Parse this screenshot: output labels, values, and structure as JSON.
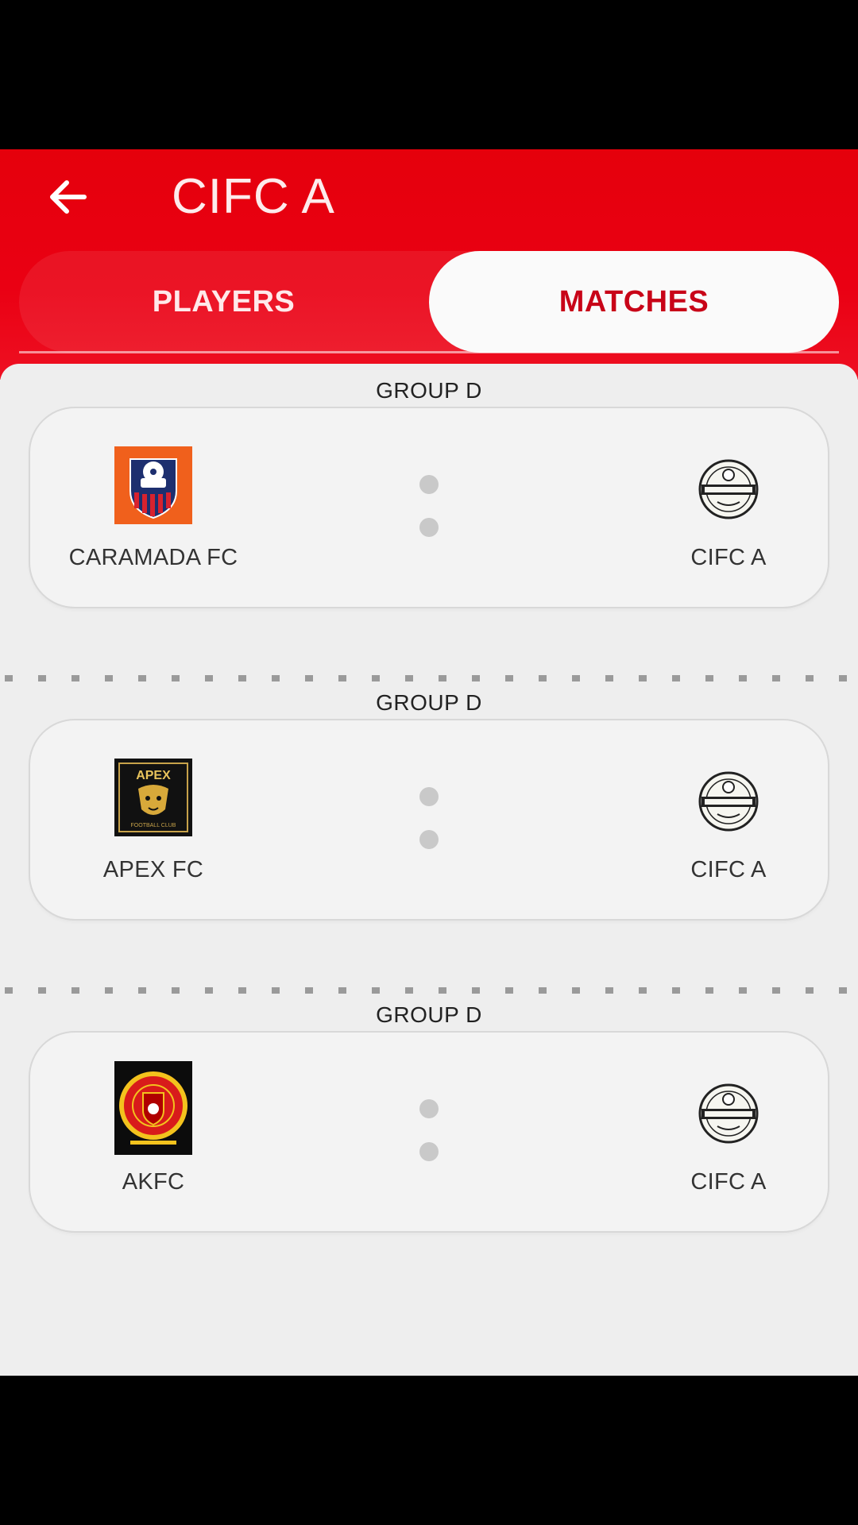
{
  "header": {
    "title": "CIFC A",
    "back_icon": "arrow-left-icon"
  },
  "tabs": [
    {
      "label": "PLAYERS",
      "selected": false
    },
    {
      "label": "MATCHES",
      "selected": true
    }
  ],
  "colors": {
    "accent": "#e5000c",
    "tab_active_text": "#c80418",
    "background": "#eeeeee"
  },
  "matches": [
    {
      "group": "GROUP D",
      "home": "CARAMADA FC",
      "away": "CIFC A"
    },
    {
      "group": "GROUP D",
      "home": "APEX FC",
      "away": "CIFC A"
    },
    {
      "group": "GROUP D",
      "home": "AKFC",
      "away": "CIFC A"
    }
  ]
}
